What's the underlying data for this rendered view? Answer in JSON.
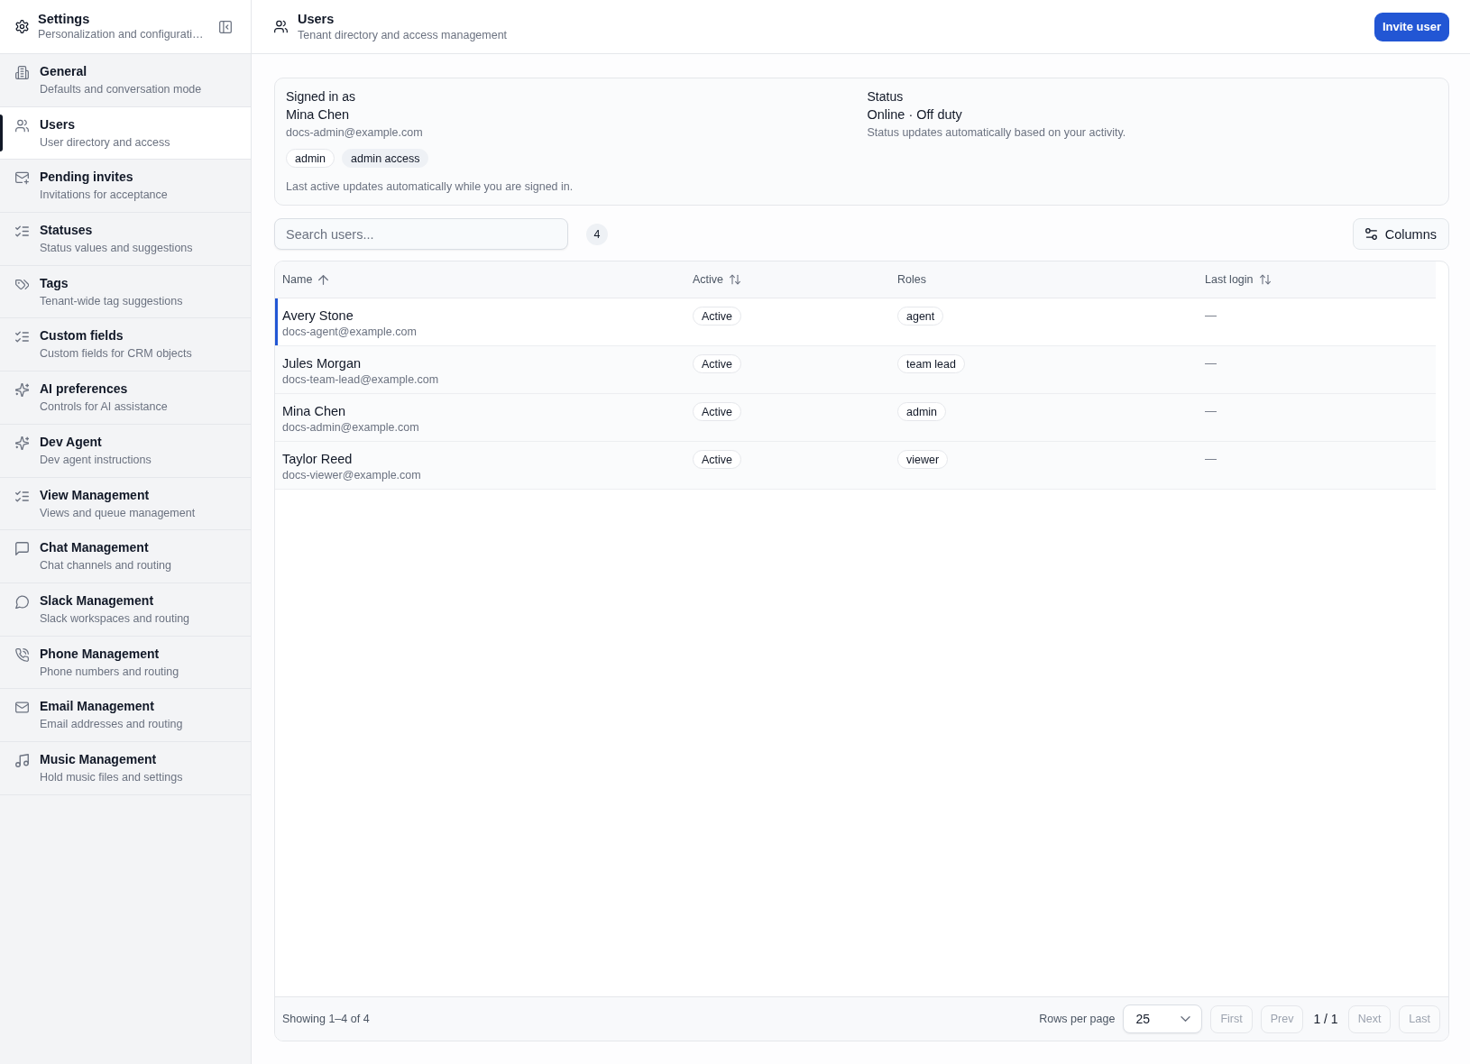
{
  "sidebar": {
    "title": "Settings",
    "subtitle": "Personalization and configurati…",
    "items": [
      {
        "title": "General",
        "subtitle": "Defaults and conversation mode",
        "selected": false
      },
      {
        "title": "Users",
        "subtitle": "User directory and access",
        "selected": true
      },
      {
        "title": "Pending invites",
        "subtitle": "Invitations for acceptance",
        "selected": false
      },
      {
        "title": "Statuses",
        "subtitle": "Status values and suggestions",
        "selected": false
      },
      {
        "title": "Tags",
        "subtitle": "Tenant-wide tag suggestions",
        "selected": false
      },
      {
        "title": "Custom fields",
        "subtitle": "Custom fields for CRM objects",
        "selected": false
      },
      {
        "title": "AI preferences",
        "subtitle": "Controls for AI assistance",
        "selected": false
      },
      {
        "title": "Dev Agent",
        "subtitle": "Dev agent instructions",
        "selected": false
      },
      {
        "title": "View Management",
        "subtitle": "Views and queue management",
        "selected": false
      },
      {
        "title": "Chat Management",
        "subtitle": "Chat channels and routing",
        "selected": false
      },
      {
        "title": "Slack Management",
        "subtitle": "Slack workspaces and routing",
        "selected": false
      },
      {
        "title": "Phone Management",
        "subtitle": "Phone numbers and routing",
        "selected": false
      },
      {
        "title": "Email Management",
        "subtitle": "Email addresses and routing",
        "selected": false
      },
      {
        "title": "Music Management",
        "subtitle": "Hold music files and settings",
        "selected": false
      }
    ]
  },
  "header": {
    "title": "Users",
    "subtitle": "Tenant directory and access management",
    "action": "Invite user"
  },
  "profile": {
    "signed_in": {
      "label": "Signed in as",
      "name": "Mina Chen",
      "email": "docs-admin@example.com",
      "chips": [
        {
          "label": "admin",
          "kind": "role"
        },
        {
          "label": "admin access",
          "kind": "access"
        }
      ],
      "note": "Last active updates automatically while you are signed in."
    },
    "status": {
      "label": "Status",
      "value": "Online · Off duty",
      "note": "Status updates automatically based on your activity."
    }
  },
  "toolbar": {
    "search": {
      "placeholder": "Search users..."
    },
    "count": "4",
    "columns_button": "Columns"
  },
  "table": {
    "columns": [
      {
        "label": "Name",
        "sortable": true,
        "sorted": true
      },
      {
        "label": "Active",
        "sortable": true,
        "sorted": false
      },
      {
        "label": "Roles",
        "sortable": false,
        "sorted": false
      },
      {
        "label": "Last login",
        "sortable": true,
        "sorted": false
      }
    ],
    "rows": [
      {
        "name": "Avery Stone",
        "email": "docs-agent@example.com",
        "active": "Active",
        "roles": [
          "agent"
        ],
        "last_login": "—",
        "selected": true
      },
      {
        "name": "Jules Morgan",
        "email": "docs-team-lead@example.com",
        "active": "Active",
        "roles": [
          "team lead"
        ],
        "last_login": "—",
        "selected": false
      },
      {
        "name": "Mina Chen",
        "email": "docs-admin@example.com",
        "active": "Active",
        "roles": [
          "admin"
        ],
        "last_login": "—",
        "selected": false
      },
      {
        "name": "Taylor Reed",
        "email": "docs-viewer@example.com",
        "active": "Active",
        "roles": [
          "viewer"
        ],
        "last_login": "—",
        "selected": false
      }
    ],
    "footer": {
      "summary": "Showing 1–4 of 4",
      "rows_per_page_label": "Rows per page",
      "rows_per_page": "25",
      "pager": [
        {
          "kind": "button",
          "label": "First",
          "disabled": true
        },
        {
          "kind": "button",
          "label": "Prev",
          "disabled": true
        },
        {
          "kind": "indicator",
          "label": "1 / 1"
        },
        {
          "kind": "button",
          "label": "Next",
          "disabled": true
        },
        {
          "kind": "button",
          "label": "Last",
          "disabled": true
        }
      ]
    }
  }
}
